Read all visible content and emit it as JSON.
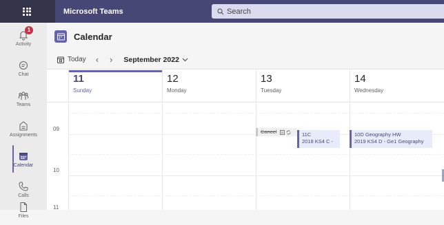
{
  "topbar": {
    "app_title": "Microsoft Teams",
    "search_placeholder": "Search"
  },
  "rail": {
    "items": [
      {
        "label": "Activity",
        "icon": "bell-icon",
        "badge": "1"
      },
      {
        "label": "Chat",
        "icon": "chat-icon"
      },
      {
        "label": "Teams",
        "icon": "teams-icon"
      },
      {
        "label": "Assignments",
        "icon": "assignments-icon"
      },
      {
        "label": "Calendar",
        "icon": "calendar-icon",
        "active": true
      },
      {
        "label": "Calls",
        "icon": "phone-icon"
      },
      {
        "label": "Files",
        "icon": "file-icon"
      }
    ]
  },
  "header": {
    "title": "Calendar"
  },
  "toolbar": {
    "today_label": "Today",
    "month_label": "September 2022"
  },
  "days": [
    {
      "num": "11",
      "name": "Sunday",
      "today": true
    },
    {
      "num": "12",
      "name": "Monday"
    },
    {
      "num": "13",
      "name": "Tuesday"
    },
    {
      "num": "14",
      "name": "Wednesday"
    }
  ],
  "hours": [
    "09",
    "10",
    "11"
  ],
  "events": {
    "cancel": {
      "label": "Cancel"
    },
    "e1": {
      "title": "11C",
      "subtitle": "2018 KS4 C -"
    },
    "e2": {
      "title": "10D Geography HW",
      "subtitle": "2019 KS4 D - Ge1 Geography"
    }
  },
  "colors": {
    "topbar": "#464775",
    "accent": "#6264a7",
    "badge": "#c4314b"
  }
}
